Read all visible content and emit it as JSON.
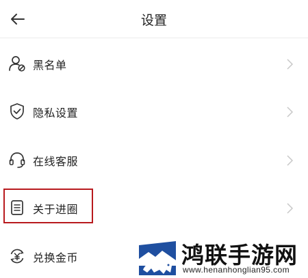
{
  "header": {
    "title": "设置",
    "back_icon": "arrow-left-icon"
  },
  "menu": [
    {
      "label": "黑名单",
      "icon": "user-block-icon"
    },
    {
      "label": "隐私设置",
      "icon": "shield-check-icon"
    },
    {
      "label": "在线客服",
      "icon": "headset-icon"
    },
    {
      "label": "关于进圈",
      "icon": "document-list-icon"
    },
    {
      "label": "兑换金币",
      "icon": "coin-exchange-icon"
    }
  ],
  "highlight": {
    "target": "关于进圈",
    "color": "#b8191d"
  },
  "watermark": {
    "name": "鸿联手游网",
    "url": "www.henanhonglian95.com",
    "logo_colors": [
      "#1f4fa0",
      "#ffffff"
    ]
  },
  "colors": {
    "icon_stroke": "#333333",
    "chevron": "#c8c8c8",
    "divider": "#ececec"
  }
}
